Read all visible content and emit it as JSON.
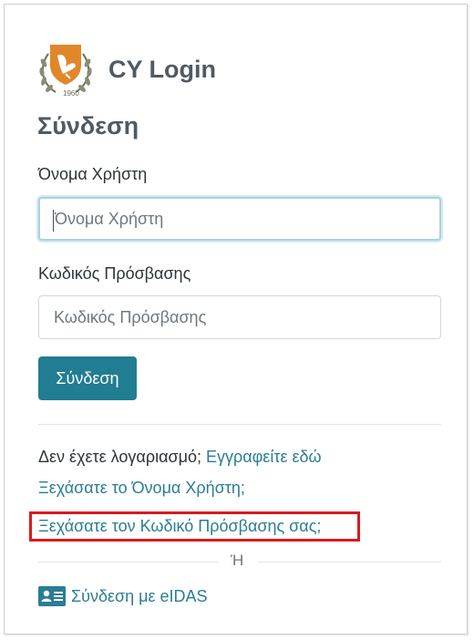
{
  "brand": {
    "name": "CY Login"
  },
  "form": {
    "title": "Σύνδεση",
    "username": {
      "label": "Όνομα Χρήστη",
      "placeholder": "Όνομα Χρήστη",
      "value": ""
    },
    "password": {
      "label": "Κωδικός Πρόσβασης",
      "placeholder": "Κωδικός Πρόσβασης",
      "value": ""
    },
    "submit_label": "Σύνδεση"
  },
  "links": {
    "no_account_text": "Δεν έχετε λογαριασμό;",
    "register": "Εγγραφείτε εδώ",
    "forgot_username": "Ξεχάσατε το Όνομα Χρήστη;",
    "forgot_password": "Ξεχάσατε τον Κωδικό Πρόσβασης σας;"
  },
  "divider_text": "Ή",
  "eidas": {
    "label": "Σύνδεση με eIDAS",
    "icon": "id-card-icon"
  },
  "colors": {
    "accent": "#217d91",
    "link": "#2a7d94",
    "highlight_border": "#d91a20",
    "title": "#505a62"
  }
}
